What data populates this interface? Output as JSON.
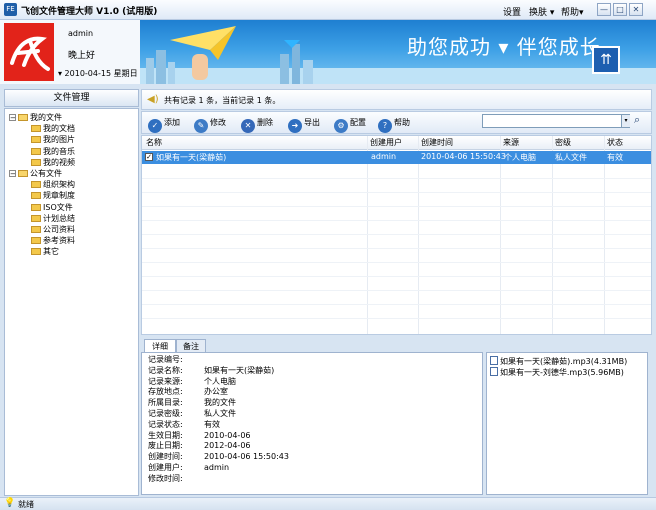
{
  "window": {
    "title": "飞创文件管理大师 V1.0 (试用版)",
    "app_icon": "FE"
  },
  "menu": {
    "settings": "设置",
    "skin": "换肤 ▾",
    "help": "帮助▾"
  },
  "window_buttons": {
    "minimize": "—",
    "restore": "□",
    "close": "✕"
  },
  "header": {
    "user_name": "admin",
    "greeting": "晚上好",
    "date_line": "▾ 2010-04-15 星期日",
    "slogan": "助您成功 ▾ 伴您成长"
  },
  "colors": {
    "accent": "#3b8ee0",
    "logo_red": "#e2231a",
    "banner_blue": "#1e7fd1"
  },
  "sidebar": {
    "title": "文件管理",
    "tree": [
      {
        "label": "我的文件",
        "level": 0,
        "expanded": true
      },
      {
        "label": "我的文档",
        "level": 1
      },
      {
        "label": "我的图片",
        "level": 1
      },
      {
        "label": "我的音乐",
        "level": 1
      },
      {
        "label": "我的视频",
        "level": 1
      },
      {
        "label": "公有文件",
        "level": 0,
        "expanded": true
      },
      {
        "label": "组织架构",
        "level": 1
      },
      {
        "label": "规章制度",
        "level": 1
      },
      {
        "label": "ISO文件",
        "level": 1
      },
      {
        "label": "计划总结",
        "level": 1
      },
      {
        "label": "公司资料",
        "level": 1
      },
      {
        "label": "参考资料",
        "level": 1
      },
      {
        "label": "其它",
        "level": 1
      }
    ]
  },
  "info_bar": {
    "text": "共有记录 1 条，当前记录 1 条。"
  },
  "toolbar": {
    "add": "添加",
    "edit": "修改",
    "delete": "删除",
    "export": "导出",
    "reset": "配置",
    "help": "帮助"
  },
  "search": {
    "value": "",
    "placeholder": ""
  },
  "table": {
    "columns": [
      "名称",
      "创建用户",
      "创建时间",
      "来源",
      "密级",
      "状态"
    ],
    "rows": [
      {
        "name": "如果有一天(梁静茹)",
        "user": "admin",
        "time": "2010-04-06 15:50:43",
        "source": "个人电脑",
        "secret": "私人文件",
        "status": "有效",
        "checked": true,
        "selected": true
      }
    ]
  },
  "tabs": {
    "detail": "详细",
    "note": "备注"
  },
  "detail": {
    "lines": [
      {
        "label": "记录编号:",
        "value": ""
      },
      {
        "label": "记录名称:",
        "value": "如果有一天(梁静茹)"
      },
      {
        "label": "记录来源:",
        "value": "个人电脑"
      },
      {
        "label": "存放地点:",
        "value": "办公室"
      },
      {
        "label": "所属目录:",
        "value": "我的文件"
      },
      {
        "label": "记录密级:",
        "value": "私人文件"
      },
      {
        "label": "记录状态:",
        "value": "有效"
      },
      {
        "label": "生效日期:",
        "value": "2010-04-06"
      },
      {
        "label": "废止日期:",
        "value": "2012-04-06"
      },
      {
        "label": "创建时间:",
        "value": "2010-04-06 15:50:43"
      },
      {
        "label": "创建用户:",
        "value": "admin"
      },
      {
        "label": "修改时间:",
        "value": ""
      }
    ]
  },
  "files": [
    {
      "name": "如果有一天(梁静茹).mp3(4.31MB)"
    },
    {
      "name": "如果有一天-刘德华.mp3(5.96MB)"
    }
  ],
  "status": {
    "text": "就绪"
  }
}
